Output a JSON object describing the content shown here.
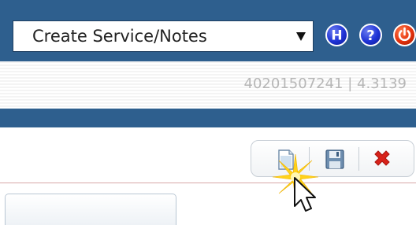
{
  "header": {
    "menu_select": {
      "value": "Create Service/Notes"
    },
    "icons": [
      {
        "name": "help-h-icon",
        "glyph": "H",
        "color": "#1f33d6"
      },
      {
        "name": "help-question-icon",
        "glyph": "?",
        "color": "#1f33d6"
      },
      {
        "name": "power-icon",
        "color": "#e3310d"
      }
    ],
    "background": "#2e5f8e"
  },
  "info": {
    "id_value": "40201507241",
    "separator": "|",
    "version": "4.3139",
    "display": "40201507241 | 4.3139"
  },
  "toolbar": {
    "buttons": [
      {
        "name": "new-document-button",
        "icon": "page-icon"
      },
      {
        "name": "save-button",
        "icon": "floppy-disk-icon"
      },
      {
        "name": "delete-button",
        "icon": "red-x-icon",
        "color": "#d8221a"
      }
    ]
  },
  "colors": {
    "accent_blue": "#2e5f8e",
    "info_text": "#b6b6b6",
    "divider": "#d8a8a8"
  }
}
